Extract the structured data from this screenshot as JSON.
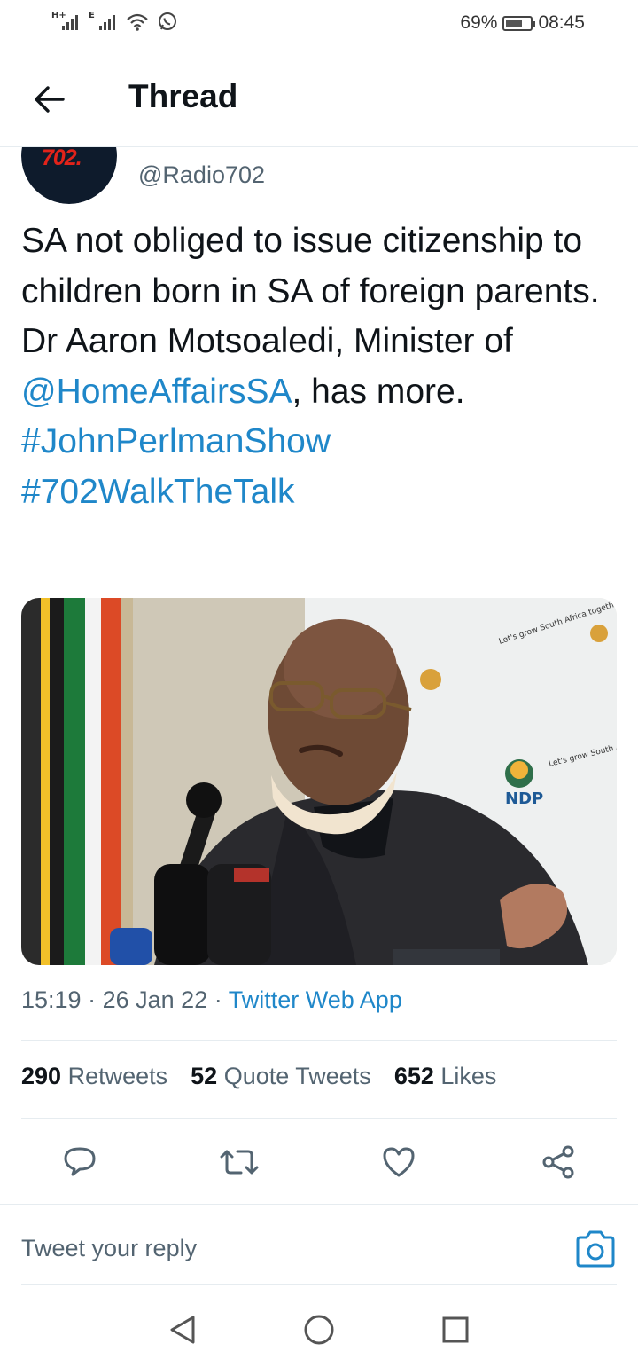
{
  "status_bar": {
    "network_1": "H+",
    "network_2": "E",
    "battery_percent": "69%",
    "battery_level": 0.69,
    "time": "08:45",
    "icons": [
      "signal-icon",
      "signal-icon",
      "wifi-icon",
      "whatsapp-icon",
      "battery-icon"
    ]
  },
  "header": {
    "title": "Thread",
    "back_icon": "arrow-left-icon"
  },
  "tweet": {
    "avatar_logo": "702.",
    "handle": "@Radio702",
    "text_part1": "SA not obliged to issue citizenship to children born in SA of foreign parents. Dr Aaron Motsoaledi, Minister of ",
    "mention": "@HomeAffairsSA",
    "text_part2": ", has more.",
    "hashtag1": "#JohnPerlmanShow",
    "hashtag2": "#702WalkTheTalk",
    "photo_banner_1": "Let's grow South Africa together",
    "photo_banner_2": "Let's grow South Africa together",
    "photo_logo": "NDP",
    "time": "15:19",
    "date": "26 Jan 22",
    "separator": "·",
    "source": "Twitter Web App"
  },
  "stats": {
    "retweets_count": "290",
    "retweets_label": "Retweets",
    "quotes_count": "52",
    "quotes_label": "Quote Tweets",
    "likes_count": "652",
    "likes_label": "Likes"
  },
  "actions": [
    "reply-icon",
    "retweet-icon",
    "like-icon",
    "share-icon"
  ],
  "reply": {
    "placeholder": "Tweet your reply",
    "camera_icon": "camera-icon"
  },
  "nav": [
    "back-nav-icon",
    "home-nav-icon",
    "recents-nav-icon"
  ],
  "colors": {
    "link": "#1f87c9",
    "text": "#0f1419",
    "muted": "#536471",
    "divider": "#e6ecf0"
  }
}
